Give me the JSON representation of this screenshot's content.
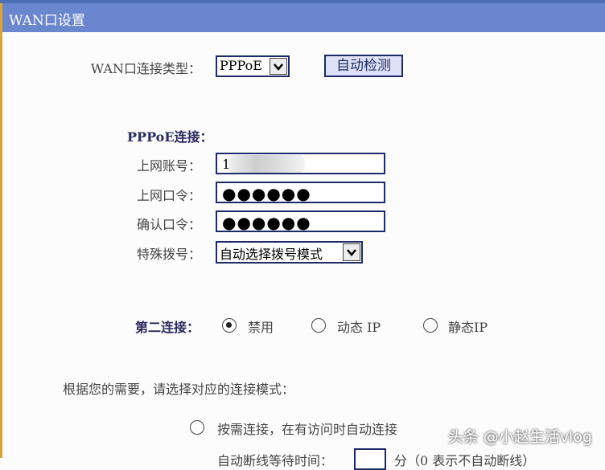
{
  "title": "WAN口设置",
  "wan_type": {
    "label": "WAN口连接类型：",
    "value": "PPPoE",
    "detect_button": "自动检测"
  },
  "pppoe": {
    "section_label": "PPPoE连接：",
    "account": {
      "label": "上网账号：",
      "value": "1"
    },
    "password": {
      "label": "上网口令：",
      "value": "●●●●●●"
    },
    "confirm": {
      "label": "确认口令：",
      "value": "●●●●●●"
    },
    "dial": {
      "label": "特殊拨号：",
      "value": "自动选择拨号模式"
    }
  },
  "second_conn": {
    "label": "第二连接：",
    "options": [
      {
        "label": "禁用",
        "checked": true
      },
      {
        "label": "动态 IP",
        "checked": false
      },
      {
        "label": "静态IP",
        "checked": false
      }
    ]
  },
  "mode": {
    "prompt": "根据您的需要，请选择对应的连接模式：",
    "on_demand": "按需连接，在有访问时自动连接",
    "idle_partial": "自动断线等待时间：",
    "idle_unit": "分（0 表示不自动断线）"
  },
  "watermark": "头条 @小赵生活vlog"
}
